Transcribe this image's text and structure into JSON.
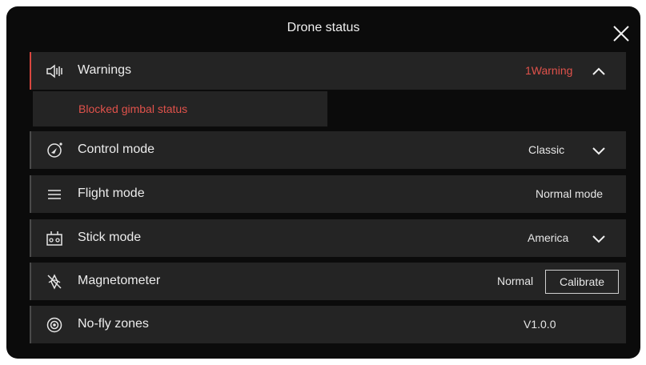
{
  "header": {
    "title": "Drone status"
  },
  "warnings": {
    "label": "Warnings",
    "count_text": "1Warning",
    "items": [
      "Blocked gimbal status"
    ]
  },
  "control_mode": {
    "label": "Control mode",
    "value": "Classic"
  },
  "flight_mode": {
    "label": "Flight mode",
    "value": "Normal mode"
  },
  "stick_mode": {
    "label": "Stick mode",
    "value": "America"
  },
  "magnetometer": {
    "label": "Magnetometer",
    "status": "Normal",
    "action": "Calibrate"
  },
  "no_fly_zones": {
    "label": "No-fly zones",
    "value": "V1.0.0"
  },
  "icons": {
    "close": "close-icon",
    "warnings": "speaker-icon",
    "control_mode": "control-mode-icon",
    "flight_mode": "menu-lines-icon",
    "stick_mode": "remote-controller-icon",
    "magnetometer": "magnetometer-icon",
    "no_fly_zones": "target-circle-icon"
  },
  "colors": {
    "background": "#0b0b0b",
    "row": "#242424",
    "warning": "#e0524b"
  }
}
